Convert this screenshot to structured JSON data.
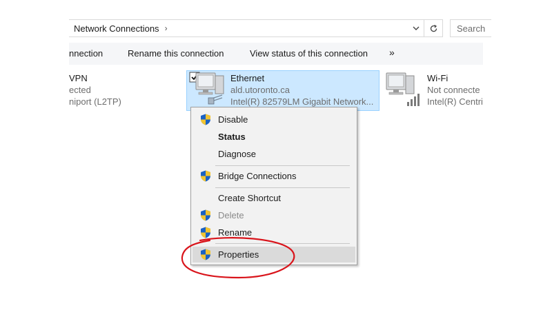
{
  "address_bar": {
    "path": "Network Connections",
    "chevron": "›",
    "dropdown_icon": "chevron-down-icon",
    "refresh_icon": "refresh-icon"
  },
  "search": {
    "placeholder": "Search"
  },
  "command_bar": {
    "items": [
      {
        "label": "nnection"
      },
      {
        "label": "Rename this connection"
      },
      {
        "label": "View status of this connection"
      },
      {
        "label": "»"
      }
    ]
  },
  "connections": {
    "vpn": {
      "name": "VPN",
      "status": "ected",
      "device": "niport (L2TP)"
    },
    "ethernet": {
      "name": "Ethernet",
      "status": "ald.utoronto.ca",
      "device": "Intel(R) 82579LM Gigabit Network..."
    },
    "wifi": {
      "name": "Wi-Fi",
      "status": "Not connecte",
      "device": "Intel(R) Centri"
    }
  },
  "context_menu": {
    "items": [
      {
        "label": "Disable",
        "shield": true,
        "bold": false,
        "disabled": false
      },
      {
        "label": "Status",
        "shield": false,
        "bold": true,
        "disabled": false
      },
      {
        "label": "Diagnose",
        "shield": false,
        "bold": false,
        "disabled": false
      },
      {
        "label": "Bridge Connections",
        "shield": true,
        "bold": false,
        "disabled": false
      },
      {
        "label": "Create Shortcut",
        "shield": false,
        "bold": false,
        "disabled": false
      },
      {
        "label": "Delete",
        "shield": true,
        "bold": false,
        "disabled": true
      },
      {
        "label": "Rename",
        "shield": true,
        "bold": false,
        "disabled": false
      },
      {
        "label": "Properties",
        "shield": true,
        "bold": false,
        "disabled": false,
        "highlighted": true
      }
    ]
  },
  "annotation": {
    "color": "#d9141b",
    "target": "Properties"
  },
  "colors": {
    "selection_bg": "#cce8ff",
    "selection_border": "#99d1ff",
    "menu_bg": "#f2f2f2"
  }
}
